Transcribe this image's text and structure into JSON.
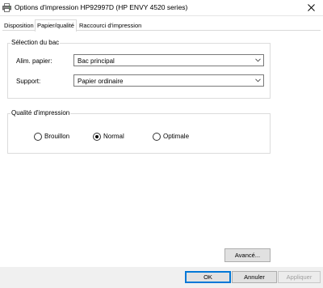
{
  "window": {
    "title": "Options d'impression HP92997D (HP ENVY 4520 series)"
  },
  "tabs": [
    {
      "label": "Disposition",
      "active": false
    },
    {
      "label": "Papier/qualité",
      "active": true
    },
    {
      "label": "Raccourci d'impression",
      "active": false
    }
  ],
  "tray_group": {
    "title": "Sélection du bac",
    "paper_source_label": "Alim. papier:",
    "paper_source_value": "Bac principal",
    "media_label": "Support:",
    "media_value": "Papier ordinaire"
  },
  "quality_group": {
    "title": "Qualité d'impression",
    "options": [
      {
        "label": "Brouillon",
        "selected": false
      },
      {
        "label": "Normal",
        "selected": true
      },
      {
        "label": "Optimale",
        "selected": false
      }
    ]
  },
  "buttons": {
    "advanced": "Avancé...",
    "ok": "OK",
    "cancel": "Annuler",
    "apply": "Appliquer"
  },
  "icons": {
    "app": "printer-icon",
    "close": "close-icon",
    "dropdown": "chevron-down-icon"
  },
  "colors": {
    "focus_border": "#0078d7",
    "footer_bg": "#f0f0f0"
  }
}
